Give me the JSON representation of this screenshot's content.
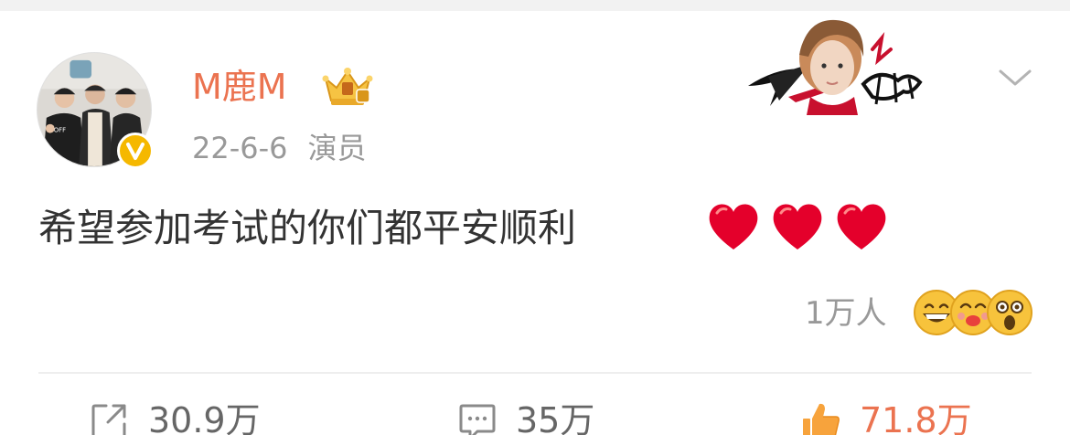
{
  "post": {
    "username": "M鹿M",
    "date": "22-6-6",
    "source": "演员",
    "text": "希望参加考试的你们都平安顺利"
  },
  "reactions": {
    "count": "1万人",
    "emojis": [
      "grinning-face",
      "kissing-face",
      "astonished-face"
    ]
  },
  "actions": {
    "repost_count": "30.9万",
    "comment_count": "35万",
    "like_count": "71.8万"
  },
  "colors": {
    "username": "#eb7350",
    "meta": "#999999",
    "verified": "#f5b800",
    "heart": "#e4002b",
    "like": "#eb7350"
  },
  "icons": {
    "verified": "verified-v-badge",
    "vip": "crown-icon",
    "menu": "chevron-down-icon",
    "repost": "share-out-icon",
    "comment": "comment-bubble-icon",
    "like": "thumbs-up-icon"
  }
}
